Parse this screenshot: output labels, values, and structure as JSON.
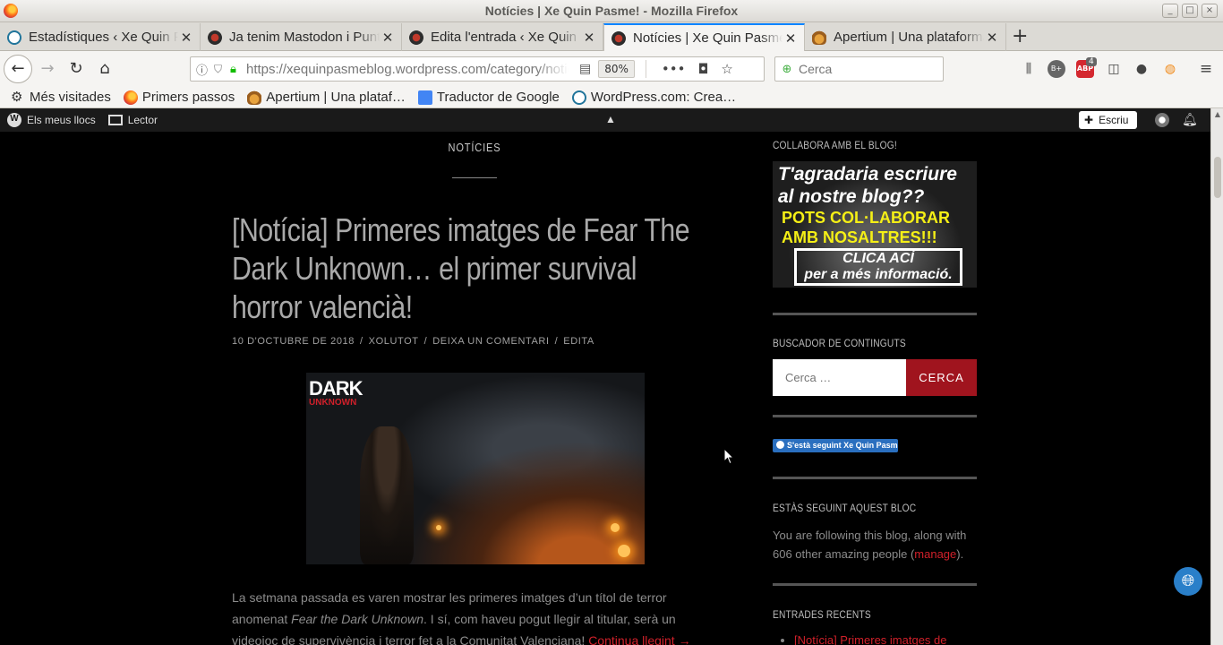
{
  "window": {
    "title": "Notícies | Xe Quin Pasme! - Mozilla Firefox",
    "controls": [
      "_",
      "□",
      "×"
    ]
  },
  "tabs": [
    {
      "label": "Estadístiques ‹ Xe Quin Pasme!",
      "favicon": "wordpress-icon"
    },
    {
      "label": "Ja tenim Mastodon i Punt Org",
      "favicon": "bug-icon"
    },
    {
      "label": "Edita l'entrada ‹ Xe Quin Pasme!",
      "favicon": "bug-icon"
    },
    {
      "label": "Notícies | Xe Quin Pasme!",
      "favicon": "bug-icon",
      "active": true
    },
    {
      "label": "Apertium | Una plataforma",
      "favicon": "apertium-icon"
    }
  ],
  "navbar": {
    "url": "https://xequinpasmeblog.wordpress.com/category/noticies/",
    "zoom": "80%",
    "search_placeholder": "Cerca",
    "abp_badge": "4",
    "abp_label": "ABP",
    "bplus_label": "B+"
  },
  "bookmarks": [
    {
      "label": "Més visitades",
      "icon": "gear-icon"
    },
    {
      "label": "Primers passos",
      "icon": "firefox-icon"
    },
    {
      "label": "Apertium | Una plataf…",
      "icon": "apertium-icon"
    },
    {
      "label": "Traductor de Google",
      "icon": "google-translate-icon"
    },
    {
      "label": "WordPress.com: Crea…",
      "icon": "wordpress-icon"
    }
  ],
  "wpbar": {
    "my_sites": "Els meus llocs",
    "reader": "Lector",
    "write": "Escriu"
  },
  "main": {
    "category": "NOTÍCIES",
    "post_title_lines": [
      "[Notícia] Primeres imatges de Fear The",
      "Dark Unknown… el primer survival",
      "horror valencià!"
    ],
    "meta": {
      "date": "10 D'OCTUBRE DE 2018",
      "author": "XOLUTOT",
      "comment": "DEIXA UN COMENTARI",
      "edit": "EDITA",
      "separator": "/"
    },
    "image_logo_main": "DARK",
    "image_logo_sub": "UNKNOWN",
    "excerpt_before": "La setmana passada es varen mostrar les primeres imatges d’un títol de terror anomenat ",
    "excerpt_em": "Fear the Dark Unknown",
    "excerpt_after": ". I sí, com haveu pogut llegir al titular, serà un videojoc de supervivència i terror fet a la Comunitat Valenciana! ",
    "continue_link": "Continua llegint →"
  },
  "sidebar": {
    "collabora_title": "COLLABORA AMB EL BLOG!",
    "banner_line1": "T'agradaria escriure",
    "banner_line2": "al nostre blog??",
    "banner_line3": "POTS COL·LABORAR",
    "banner_line4": "AMB NOSALTRES!!!",
    "banner_line5": "CLICA ACÍ",
    "banner_line6": "per a més informació.",
    "search_title": "BUSCADOR DE CONTINGUTS",
    "search_placeholder": "Cerca …",
    "search_button": "CERCA",
    "follow_button": "S'està seguint Xe Quin Pasme!",
    "following_title": "ESTÀS SEGUINT AQUEST BLOC",
    "following_text_before": "You are following this blog, along with 606 other amazing people (",
    "following_link": "manage",
    "following_text_after": ").",
    "recent_title": "ENTRADES RECENTS",
    "recent_items": [
      "[Notícia] Primeres imatges de"
    ]
  },
  "colors": {
    "accent_red": "#d0202a",
    "search_button": "#a0141e",
    "firefox_tab_highlight": "#0a84ff"
  }
}
